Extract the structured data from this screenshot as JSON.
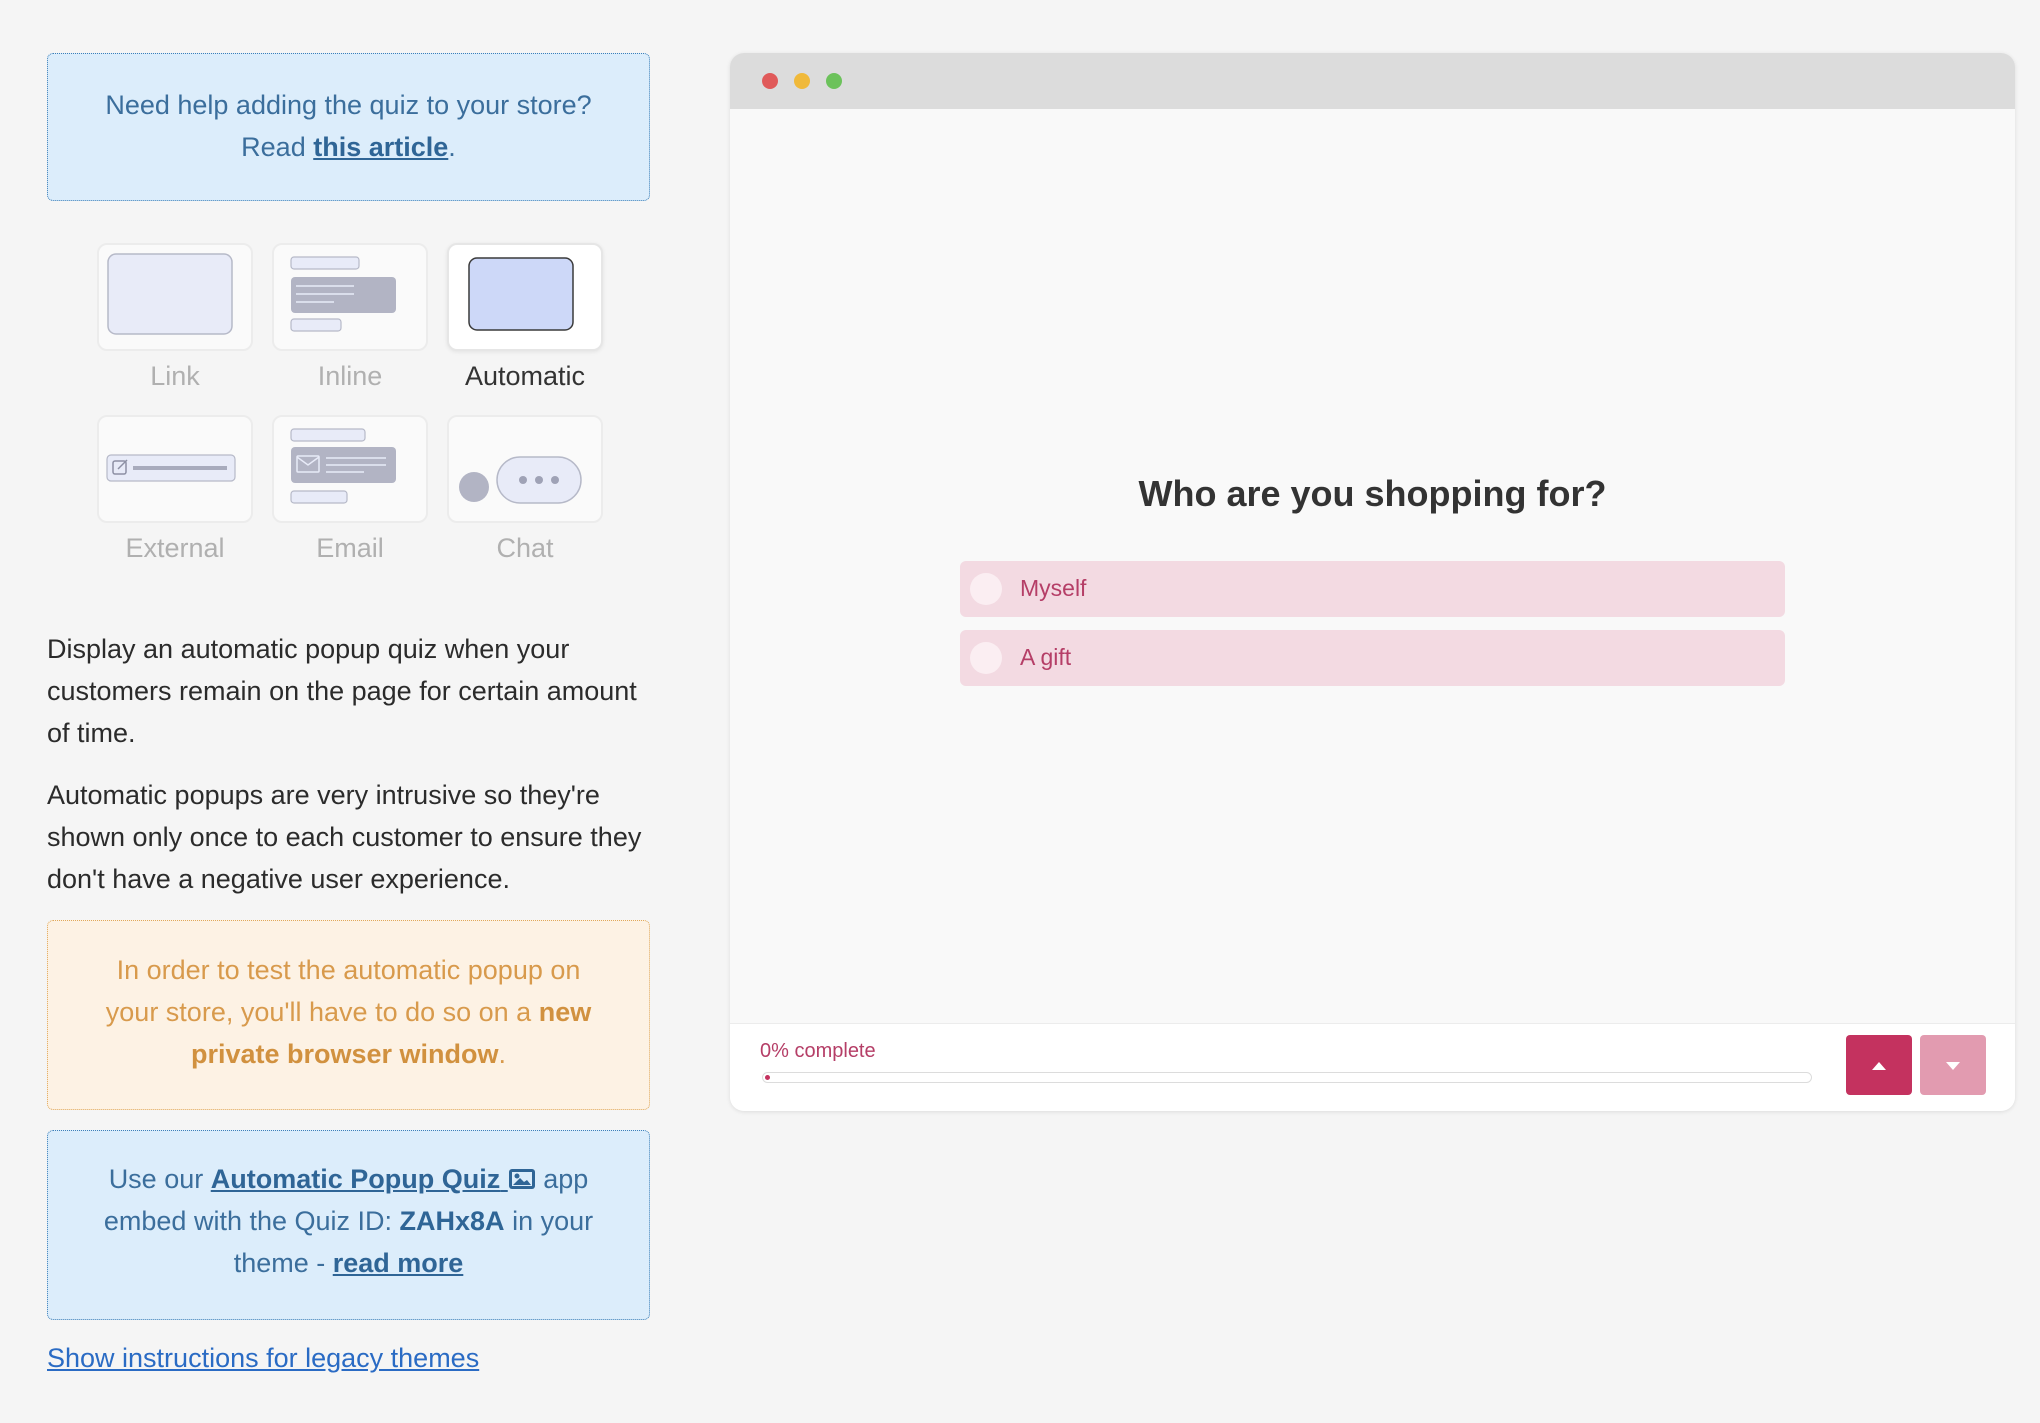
{
  "help": {
    "line1": "Need help adding the quiz to your store?",
    "read_prefix": "Read ",
    "link_text": "this article",
    "suffix": "."
  },
  "modes": [
    {
      "label": "Link",
      "selected": false
    },
    {
      "label": "Inline",
      "selected": false
    },
    {
      "label": "Automatic",
      "selected": true
    },
    {
      "label": "External",
      "selected": false
    },
    {
      "label": "Email",
      "selected": false
    },
    {
      "label": "Chat",
      "selected": false
    }
  ],
  "description": {
    "p1": "Display an automatic popup quiz when your customers remain on the page for certain amount of time.",
    "p2": "Automatic popups are very intrusive so they're shown only once to each customer to ensure they don't have a negative user experience."
  },
  "warning": {
    "prefix": "In order to test the automatic popup on your store, you'll have to do so on a ",
    "bold": "new private browser window",
    "suffix": "."
  },
  "embed": {
    "prefix": "Use our ",
    "app_link": "Automatic Popup Quiz",
    "middle": " app embed with the Quiz ID: ",
    "quiz_id": "ZAHx8A",
    "after_id": " in your theme - ",
    "read_more": "read more"
  },
  "legacy_link": "Show instructions for legacy themes",
  "preview": {
    "question": "Who are you shopping for?",
    "options": [
      "Myself",
      "A gift"
    ],
    "progress_label": "0% complete",
    "progress_value": 0,
    "colors": {
      "accent": "#c4325f",
      "accent_light": "#e29bb0",
      "option_bg": "#f3dae2"
    },
    "window_dots": [
      "#e05a5a",
      "#f0b93a",
      "#6cc25b"
    ],
    "nav_icons": [
      "caret-up-icon",
      "caret-down-icon"
    ]
  }
}
